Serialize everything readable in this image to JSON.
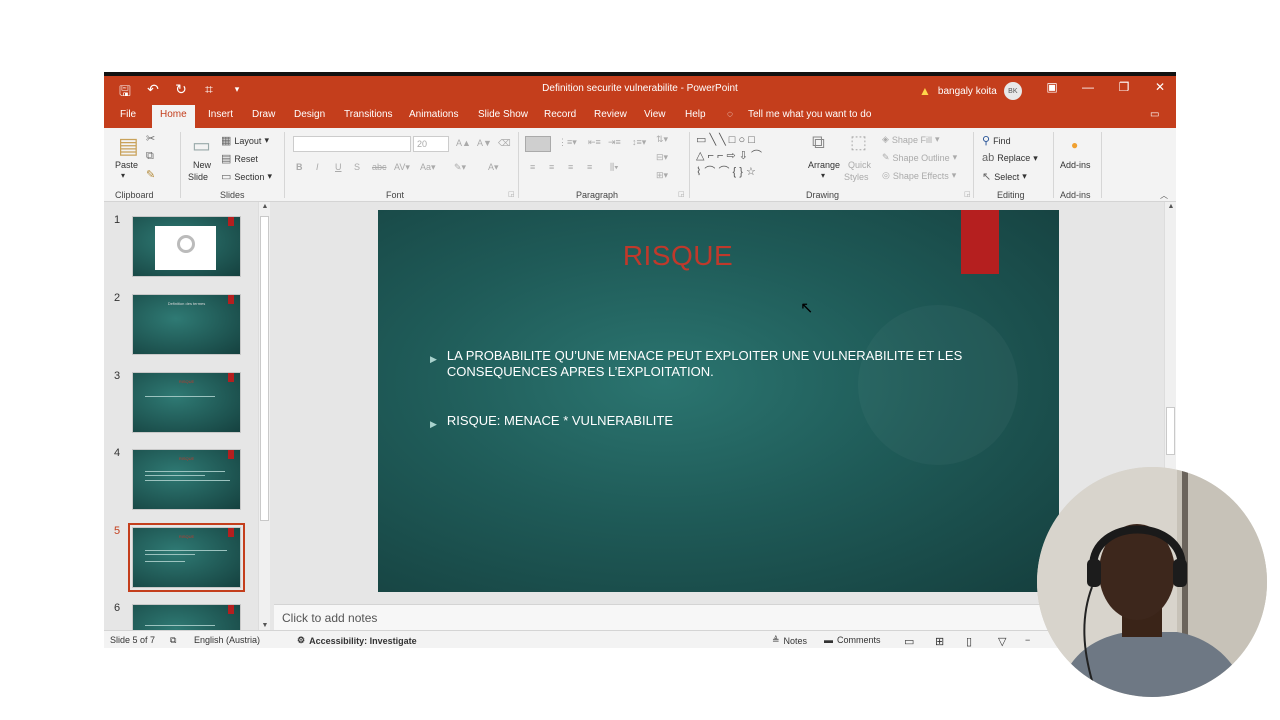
{
  "window": {
    "title": "Definition securite vulnerabilite  -  PowerPoint",
    "user_name": "bangaly koita",
    "user_initials": "BK"
  },
  "tabs": [
    "File",
    "Home",
    "Insert",
    "Draw",
    "Design",
    "Transitions",
    "Animations",
    "Slide Show",
    "Record",
    "Review",
    "View",
    "Help"
  ],
  "tell_me": "Tell me what you want to do",
  "ribbon": {
    "clipboard": {
      "paste": "Paste",
      "label": "Clipboard"
    },
    "slides": {
      "new_slide_1": "New",
      "new_slide_2": "Slide",
      "layout": "Layout",
      "reset": "Reset",
      "section": "Section",
      "label": "Slides"
    },
    "font": {
      "size": "20",
      "label": "Font"
    },
    "paragraph": {
      "label": "Paragraph"
    },
    "drawing": {
      "arrange": "Arrange",
      "quick_styles_1": "Quick",
      "quick_styles_2": "Styles",
      "shape_fill": "Shape Fill",
      "shape_outline": "Shape Outline",
      "shape_effects": "Shape Effects",
      "label": "Drawing"
    },
    "editing": {
      "find": "Find",
      "replace": "Replace",
      "select": "Select",
      "label": "Editing"
    },
    "addins": {
      "button": "Add-ins",
      "label": "Add-ins"
    }
  },
  "thumbnails": [
    {
      "num": "1",
      "title": ""
    },
    {
      "num": "2",
      "title": "Definition des termes"
    },
    {
      "num": "3",
      "title": "RISQUE"
    },
    {
      "num": "4",
      "title": "RISQUE"
    },
    {
      "num": "5",
      "title": "RISQUE"
    },
    {
      "num": "6",
      "title": ""
    }
  ],
  "slide": {
    "title": "RISQUE",
    "bullets": [
      "LA PROBABILITE QU’UNE MENACE PEUT  EXPLOITER UNE VULNERABILITE ET LES CONSEQUENCES APRES L’EXPLOITATION.",
      "RISQUE: MENACE * VULNERABILITE"
    ]
  },
  "notes_placeholder": "Click to add notes",
  "status": {
    "slide_counter": "Slide 5 of 7",
    "language": "English (Austria)",
    "accessibility": "Accessibility: Investigate",
    "notes": "Notes",
    "comments": "Comments"
  },
  "colors": {
    "accent": "#c43e1c",
    "slide_bg": "#1f5b58",
    "title_red": "#c0392b"
  }
}
